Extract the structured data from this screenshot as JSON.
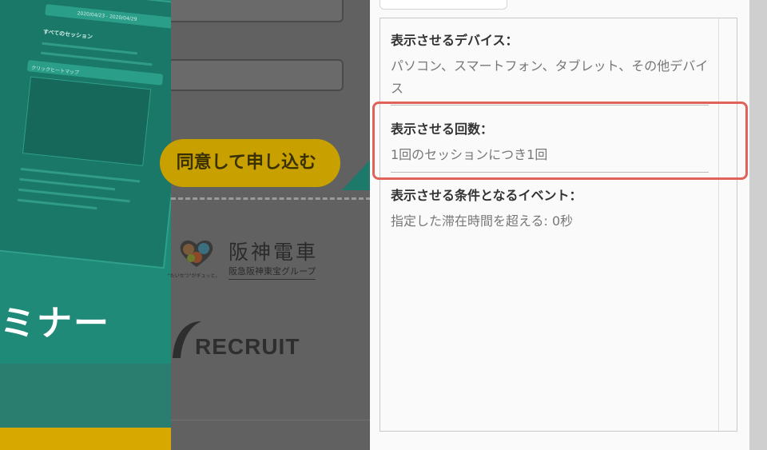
{
  "background": {
    "hero": {
      "date_range": "2020/04/23 - 2020/04/29",
      "panel_title": "すべてのセッション",
      "panel_dropdown": "クリックヒートマップ",
      "title": "ミナー"
    },
    "cta_label": "同意して申し込む",
    "logos": {
      "hanshin_name": "阪神電車",
      "hanshin_group": "阪急阪神東宝グループ",
      "hanshin_tagline": "\"たいせつ\"がギュッと。",
      "recruit": "RECRUIT"
    }
  },
  "panel": {
    "sections": [
      {
        "title": "表示させるデバイス：",
        "value": "パソコン、スマートフォン、タブレット、その他デバイス"
      },
      {
        "title": "表示させる回数：",
        "value": "1回のセッションにつき1回"
      },
      {
        "title": "表示させる条件となるイベント：",
        "value": "指定した滞在時間を超える: 0秒"
      }
    ],
    "highlight_color": "#e0635a"
  },
  "colors": {
    "hero_teal": "#1f8a78",
    "cta_yellow": "#c8a000",
    "overlay_gray": "#616161"
  }
}
